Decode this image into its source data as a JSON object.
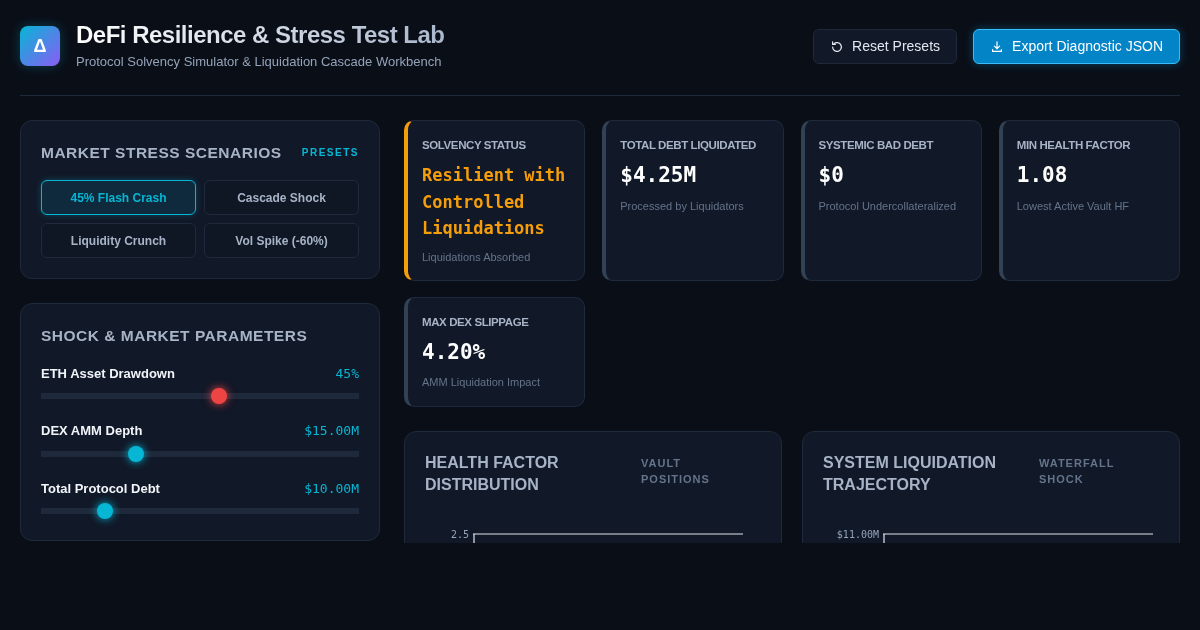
{
  "header": {
    "logo_glyph": "Δ",
    "title": "DeFi Resilience & Stress Test Lab",
    "subtitle": "Protocol Solvency Simulator & Liquidation Cascade Workbench"
  },
  "actions": [
    {
      "kind": "reset",
      "label": "Reset Presets"
    },
    {
      "kind": "export",
      "label": "Export Diagnostic JSON"
    }
  ],
  "scenarios": {
    "title": "MARKET STRESS SCENARIOS",
    "tag": "PRESETS",
    "presets": [
      {
        "label": "45% Flash Crash",
        "selected": true
      },
      {
        "label": "Cascade Shock",
        "selected": false
      },
      {
        "label": "Liquidity Crunch",
        "selected": false
      },
      {
        "label": "Vol Spike (-60%)",
        "selected": false
      }
    ]
  },
  "parameters": {
    "title": "SHOCK & MARKET PARAMETERS",
    "sliders": [
      {
        "label": "ETH Asset Drawdown",
        "reading": "45%",
        "level": 0.56,
        "color": "#ef4444"
      },
      {
        "label": "DEX AMM Depth",
        "reading": "$15.00M",
        "level": 0.3,
        "color": "#06b6d4"
      },
      {
        "label": "Total Protocol Debt",
        "reading": "$10.00M",
        "level": 0.2,
        "color": "#06b6d4"
      }
    ]
  },
  "metrics": [
    {
      "label": "SOLVENCY STATUS",
      "value": "Resilient with Controlled Liquidations",
      "note": "Liquidations Absorbed",
      "color": "#f59e0b"
    },
    {
      "label": "TOTAL DEBT LIQUIDATED",
      "value": "$4.25M",
      "note": "Processed by Liquidators",
      "color": "#334155"
    },
    {
      "label": "SYSTEMIC BAD DEBT",
      "value": "$0",
      "note": "Protocol Undercollateralized",
      "color": "#334155"
    },
    {
      "label": "MIN HEALTH FACTOR",
      "value": "1.08",
      "note": "Lowest Active Vault HF",
      "color": "#334155"
    },
    {
      "label": "MAX DEX SLIPPAGE",
      "value": "4.20%",
      "note": "AMM Liquidation Impact",
      "color": "#334155"
    }
  ],
  "charts": [
    {
      "title": "HEALTH FACTOR DISTRIBUTION",
      "tag": "VAULT POSITIONS",
      "tick_label": "2.5"
    },
    {
      "title": "SYSTEM LIQUIDATION TRAJECTORY",
      "tag": "WATERFALL SHOCK",
      "tick_label": "$11.00M"
    }
  ]
}
